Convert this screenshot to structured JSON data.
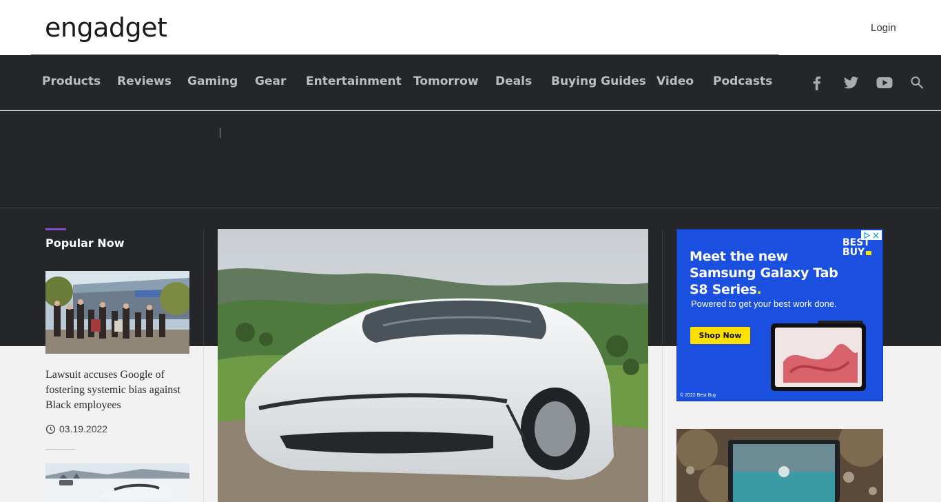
{
  "header": {
    "logo_text": "engadget",
    "login_label": "Login"
  },
  "nav": {
    "items": [
      {
        "label": "Products"
      },
      {
        "label": "Reviews"
      },
      {
        "label": "Gaming"
      },
      {
        "label": "Gear"
      },
      {
        "label": "Entertainment"
      },
      {
        "label": "Tomorrow"
      },
      {
        "label": "Deals"
      },
      {
        "label": "Buying Guides"
      },
      {
        "label": "Video"
      },
      {
        "label": "Podcasts"
      }
    ],
    "social_icons": [
      "facebook-icon",
      "twitter-icon",
      "youtube-icon",
      "search-icon"
    ]
  },
  "popular": {
    "heading": "Popular Now",
    "stories": [
      {
        "title": "Lawsuit accuses Google of fostering systemic bias against Black employees",
        "date": "03.19.2022"
      }
    ]
  },
  "ad": {
    "headline_main": "Meet the new Samsung Galaxy Tab S8 Series",
    "headline_dot": ".",
    "subtext": "Powered to get your best work done.",
    "cta_label": "Shop Now",
    "brand_line1": "BEST",
    "brand_line2": "BUY",
    "copyright": "© 2022 Best Buy"
  },
  "colors": {
    "nav_bg": "#25262a",
    "accent_purple": "#8a49c8",
    "ad_blue": "#1a4fe0",
    "ad_yellow": "#ffe000"
  }
}
